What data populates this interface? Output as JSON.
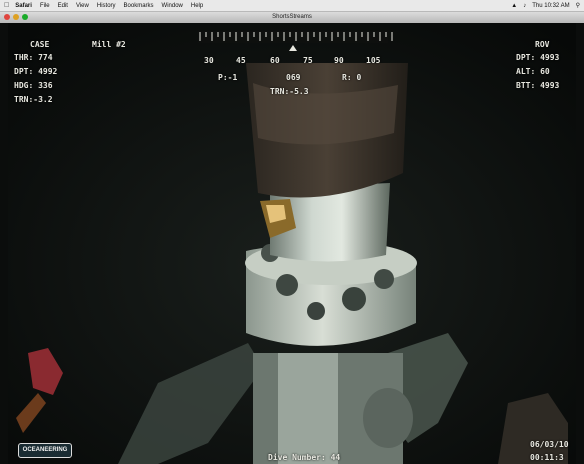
{
  "menubar": {
    "apple": "",
    "items": [
      "Safari",
      "File",
      "Edit",
      "View",
      "History",
      "Bookmarks",
      "Window",
      "Help"
    ],
    "clock": "Thu 10:32 AM"
  },
  "window": {
    "title": "ShortsStreams"
  },
  "overlay": {
    "left_header": "CASE",
    "left_lines": [
      "THR: 774",
      "DPT: 4992",
      "HDG: 336",
      "TRN:-3.2"
    ],
    "mid_header": "Mill #2",
    "scale_ticks": [
      "30",
      "45",
      "60",
      "75",
      "90",
      "105"
    ],
    "mid_values": [
      "P:-1",
      "069",
      "R: 0"
    ],
    "mid_trn": "TRN:-5.3",
    "right_header": "ROV",
    "right_lines": [
      "DPT: 4993",
      "ALT: 60",
      "BTT: 4993"
    ],
    "date": "06/03/10",
    "time": "00:11:3",
    "dive": "Dive Number: 44"
  },
  "logo": {
    "text": "OCEANEERING"
  },
  "colors": {
    "background": "#0b0d0c",
    "overlay_text": "#e8e8e0"
  }
}
